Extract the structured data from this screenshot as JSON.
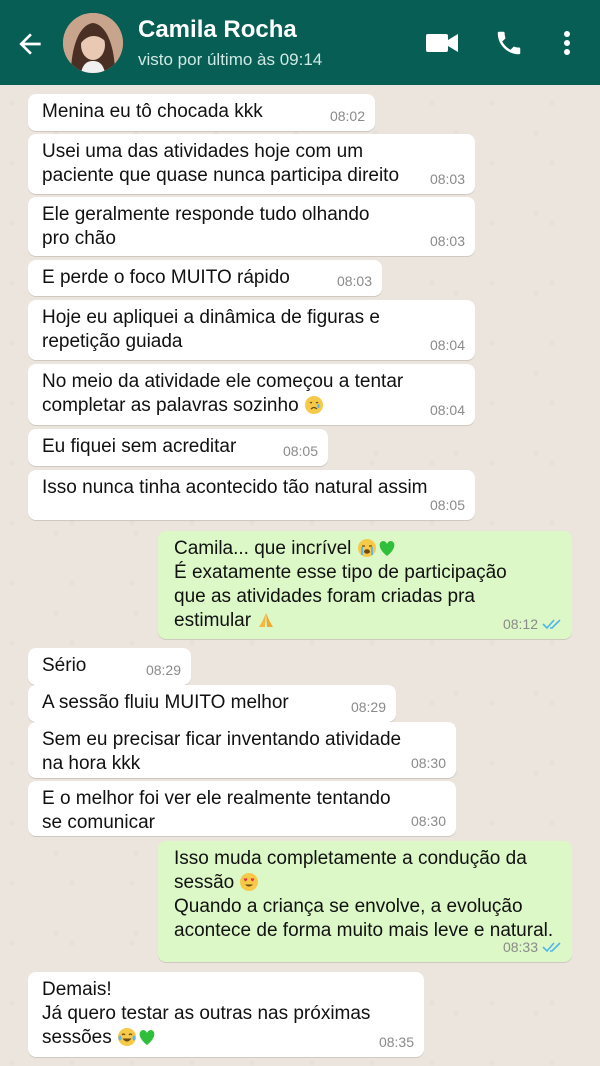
{
  "header": {
    "contact_name": "Camila Rocha",
    "status": "visto por último às 09:14",
    "icons": [
      "back-arrow-icon",
      "video-call-icon",
      "phone-icon",
      "more-options-icon"
    ],
    "bg_color": "#075E54"
  },
  "messages": [
    {
      "dir": "in",
      "text": "Menina eu tô chocada kkk",
      "time": "08:02"
    },
    {
      "dir": "in",
      "text": "Usei uma das atividades hoje com um\npaciente que quase nunca participa direito",
      "time": "08:03"
    },
    {
      "dir": "in",
      "text": "Ele geralmente responde tudo olhando\npro chão",
      "time": "08:03"
    },
    {
      "dir": "in",
      "text": "E perde o foco MUITO rápido",
      "time": "08:03"
    },
    {
      "dir": "in",
      "text": "Hoje eu apliquei a dinâmica de figuras e\nrepetição guiada",
      "time": "08:04"
    },
    {
      "dir": "in",
      "text": "No meio da atividade ele começou a tentar\ncompletar as palavras sozinho",
      "emoji": "crying-face",
      "time": "08:04"
    },
    {
      "dir": "in",
      "text": "Eu fiquei sem acreditar",
      "time": "08:05"
    },
    {
      "dir": "in",
      "text": "Isso nunca tinha acontecido tão natural assim",
      "time": "08:05"
    },
    {
      "dir": "out",
      "text_line1": "Camila... que incrível",
      "text_rest": "É exatamente esse tipo de participação\nque as atividades foram criadas pra\nestimular",
      "emojis": [
        "loudly-crying-face",
        "green-heart",
        "folded-hands"
      ],
      "time": "08:12",
      "status": "read"
    },
    {
      "dir": "in",
      "text": "Sério",
      "time": "08:29"
    },
    {
      "dir": "in",
      "text": "A sessão fluiu MUITO melhor",
      "time": "08:29"
    },
    {
      "dir": "in",
      "text": "Sem eu precisar ficar inventando atividade\nna hora kkk",
      "time": "08:30"
    },
    {
      "dir": "in",
      "text": "E o melhor foi ver ele realmente tentando\nse comunicar",
      "time": "08:30"
    },
    {
      "dir": "out",
      "text_line1": "Isso muda completamente a condução da\nsessão",
      "text_rest": "Quando a criança se envolve, a evolução\nacontece de forma muito mais leve e natural.",
      "emojis": [
        "heart-eyes-face"
      ],
      "time": "08:33",
      "status": "read"
    },
    {
      "dir": "in",
      "text": "Demais!\nJá quero testar as outras nas próximas\nsessões",
      "emojis": [
        "tears-of-joy-face",
        "green-heart"
      ],
      "time": "08:35"
    }
  ],
  "colors": {
    "incoming_bubble": "#ffffff",
    "outgoing_bubble": "#dcf8c6",
    "read_check": "#4fb6ec",
    "chat_background": "#ECE5DD"
  }
}
